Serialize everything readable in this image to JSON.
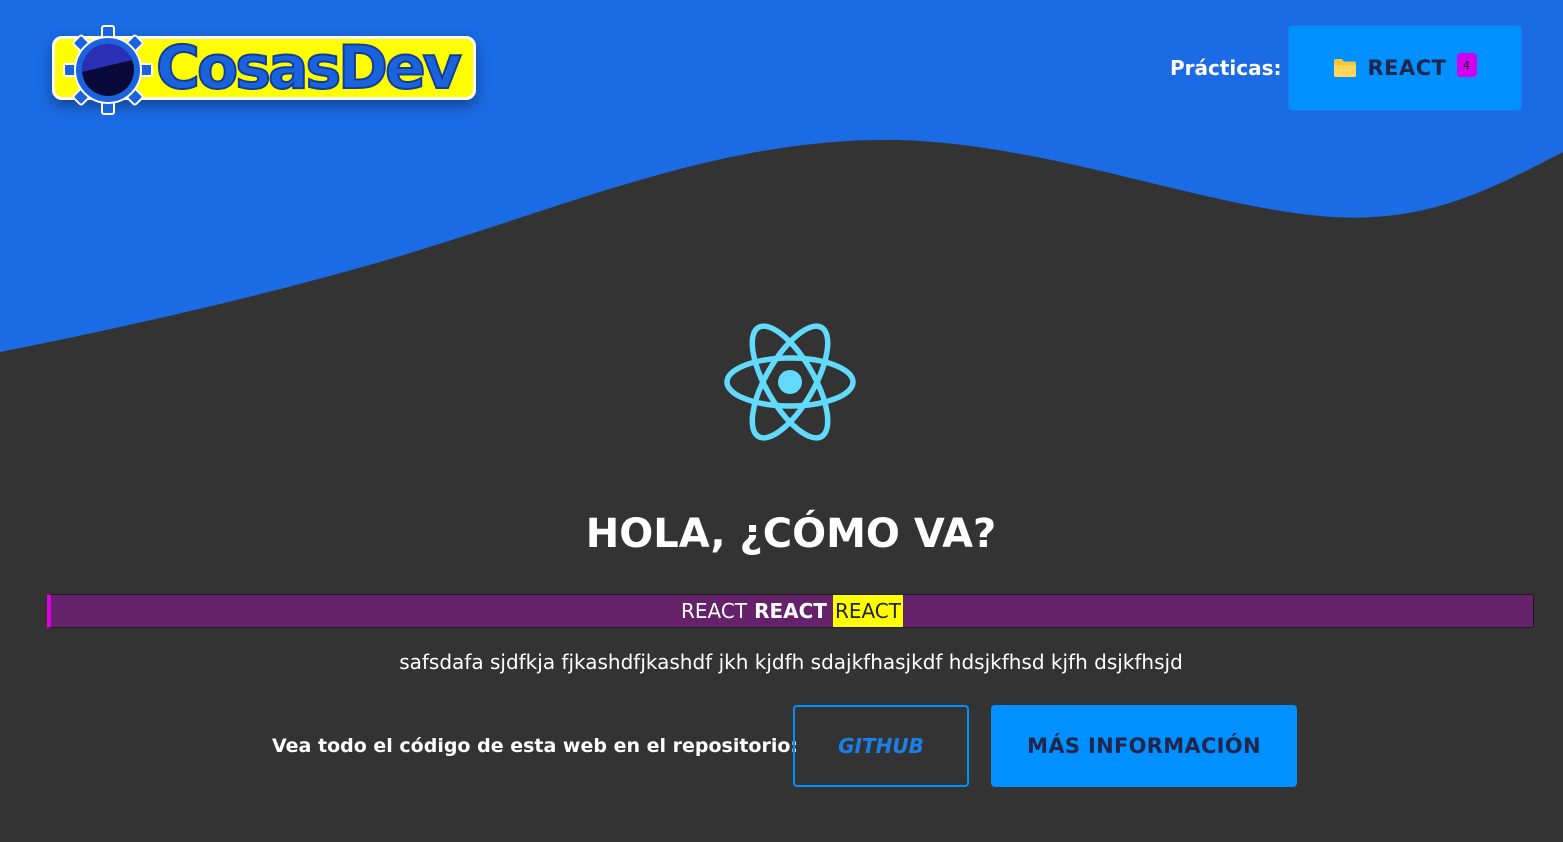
{
  "colors": {
    "background": "#333333",
    "header_blue": "#1a6be4",
    "accent_button": "#0090ff",
    "logo_yellow": "#ffff00",
    "banner_purple": "#652169",
    "highlight_yellow": "#ffff00",
    "react_cyan": "#61dafb"
  },
  "header": {
    "logo_text": "CosasDev",
    "logo_icon": "gear-icon",
    "nav_label": "Prácticas:",
    "react_button": {
      "icon": "folder-icon",
      "label": "REACT",
      "badge": "4"
    }
  },
  "hero": {
    "icon": "react-atom-icon",
    "title": "HOLA, ¿CÓMO VA?"
  },
  "banner": {
    "part1": "REACT",
    "part2": "REACT",
    "part3": "REACT"
  },
  "lorem_text": "safsdafa sjdfkja fjkashdfjkashdf jkh kjdfh sdajkfhasjkdf hdsjkfhsd kjfh dsjkfhsjd",
  "repo": {
    "label": "Vea todo el código de esta web en el repositorio:",
    "github_button": "GITHUB",
    "info_button": "MÁS INFORMACIÓN"
  }
}
